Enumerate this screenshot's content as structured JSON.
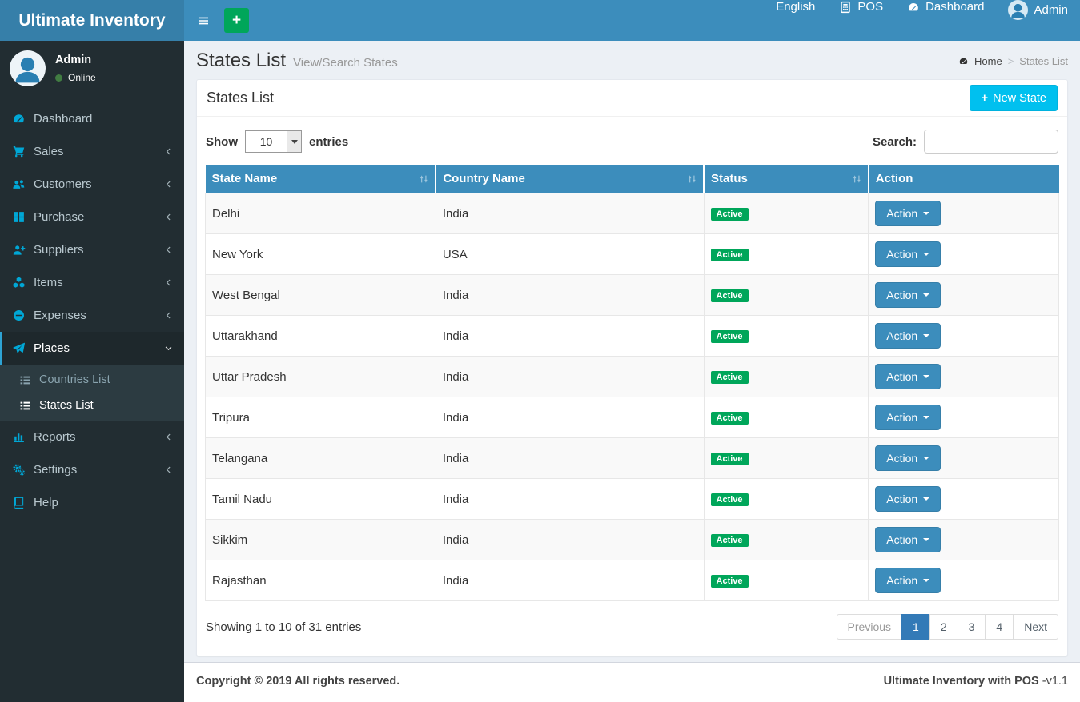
{
  "colors": {
    "navbar": "#3c8dbc",
    "logo_bg": "#367fa9",
    "sidebar_bg": "#222d32",
    "accent_cyan": "#00c0ef",
    "success_green": "#00a65a",
    "table_header": "#3c8dbc",
    "pagination_active": "#337ab7"
  },
  "navbar": {
    "brand": "Ultimate Inventory",
    "items": [
      {
        "label": "English",
        "icon": null
      },
      {
        "label": "POS",
        "icon": "calculator-icon"
      },
      {
        "label": "Dashboard",
        "icon": "dashboard-icon"
      },
      {
        "label": "Admin",
        "icon": "user-avatar"
      }
    ]
  },
  "sidebar": {
    "user": {
      "name": "Admin",
      "status": "Online"
    },
    "items": [
      {
        "label": "Dashboard",
        "icon": "dashboard-icon",
        "expandable": false,
        "active": false
      },
      {
        "label": "Sales",
        "icon": "cart-icon",
        "expandable": true,
        "active": false
      },
      {
        "label": "Customers",
        "icon": "users-icon",
        "expandable": true,
        "active": false
      },
      {
        "label": "Purchase",
        "icon": "grid-icon",
        "expandable": true,
        "active": false
      },
      {
        "label": "Suppliers",
        "icon": "user-plus-icon",
        "expandable": true,
        "active": false
      },
      {
        "label": "Items",
        "icon": "cubes-icon",
        "expandable": true,
        "active": false
      },
      {
        "label": "Expenses",
        "icon": "minus-circle-icon",
        "expandable": true,
        "active": false
      },
      {
        "label": "Places",
        "icon": "paper-plane-icon",
        "expandable": true,
        "active": true,
        "expanded": true,
        "children": [
          {
            "label": "Countries List",
            "icon": "list-icon",
            "active": false
          },
          {
            "label": "States List",
            "icon": "list-icon",
            "active": true
          }
        ]
      },
      {
        "label": "Reports",
        "icon": "bar-chart-icon",
        "expandable": true,
        "active": false
      },
      {
        "label": "Settings",
        "icon": "gears-icon",
        "expandable": true,
        "active": false
      },
      {
        "label": "Help",
        "icon": "book-icon",
        "expandable": false,
        "active": false
      }
    ]
  },
  "content": {
    "page_title": "States List",
    "page_subtitle": "View/Search States",
    "breadcrumb": {
      "home": "Home",
      "separator": ">",
      "current": "States List"
    },
    "box": {
      "title": "States List",
      "new_button": "New State",
      "length_label_before": "Show",
      "length_value": "10",
      "length_label_after": "entries",
      "search_label": "Search:",
      "search_value": ""
    },
    "table": {
      "columns": [
        {
          "label": "State Name",
          "sortable": true
        },
        {
          "label": "Country Name",
          "sortable": true
        },
        {
          "label": "Status",
          "sortable": true
        },
        {
          "label": "Action",
          "sortable": false
        }
      ],
      "rows": [
        {
          "state": "Delhi",
          "country": "India",
          "status": "Active",
          "action": "Action"
        },
        {
          "state": "New York",
          "country": "USA",
          "status": "Active",
          "action": "Action"
        },
        {
          "state": "West Bengal",
          "country": "India",
          "status": "Active",
          "action": "Action"
        },
        {
          "state": "Uttarakhand",
          "country": "India",
          "status": "Active",
          "action": "Action"
        },
        {
          "state": "Uttar Pradesh",
          "country": "India",
          "status": "Active",
          "action": "Action"
        },
        {
          "state": "Tripura",
          "country": "India",
          "status": "Active",
          "action": "Action"
        },
        {
          "state": "Telangana",
          "country": "India",
          "status": "Active",
          "action": "Action"
        },
        {
          "state": "Tamil Nadu",
          "country": "India",
          "status": "Active",
          "action": "Action"
        },
        {
          "state": "Sikkim",
          "country": "India",
          "status": "Active",
          "action": "Action"
        },
        {
          "state": "Rajasthan",
          "country": "India",
          "status": "Active",
          "action": "Action"
        }
      ]
    },
    "info_text": "Showing 1 to 10 of 31 entries",
    "pagination": {
      "previous": "Previous",
      "pages": [
        "1",
        "2",
        "3",
        "4"
      ],
      "active_page": "1",
      "next": "Next"
    }
  },
  "footer": {
    "left": "Copyright © 2019 All rights reserved.",
    "right_strong": "Ultimate Inventory with POS",
    "right_version": " -v1.1"
  }
}
